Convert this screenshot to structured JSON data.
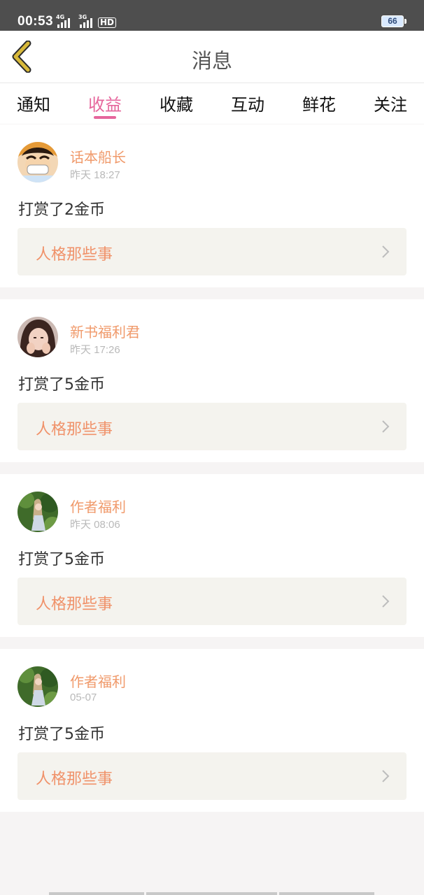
{
  "status": {
    "time": "00:53",
    "net1": "4G",
    "net2": "3G",
    "hd": "HD",
    "battery": "66"
  },
  "header": {
    "title": "消息",
    "back_icon": "chevron-left-icon"
  },
  "tabs": [
    {
      "label": "通知",
      "active": false
    },
    {
      "label": "收益",
      "active": true
    },
    {
      "label": "收藏",
      "active": false
    },
    {
      "label": "互动",
      "active": false
    },
    {
      "label": "鲜花",
      "active": false
    },
    {
      "label": "关注",
      "active": false
    }
  ],
  "messages": [
    {
      "sender": "话本船长",
      "time": "昨天 18:27",
      "text": "打赏了2金币",
      "book": "人格那些事"
    },
    {
      "sender": "新书福利君",
      "time": "昨天 17:26",
      "text": "打赏了5金币",
      "book": "人格那些事"
    },
    {
      "sender": "作者福利",
      "time": "昨天 08:06",
      "text": "打赏了5金币",
      "book": "人格那些事"
    },
    {
      "sender": "作者福利",
      "time": "05-07",
      "text": "打赏了5金币",
      "book": "人格那些事"
    }
  ],
  "colors": {
    "accent": "#e6669c",
    "name": "#f09a6b",
    "book_text": "#f0926a",
    "book_bg": "#f4f3ee",
    "back_icon": "#d8b93a"
  }
}
